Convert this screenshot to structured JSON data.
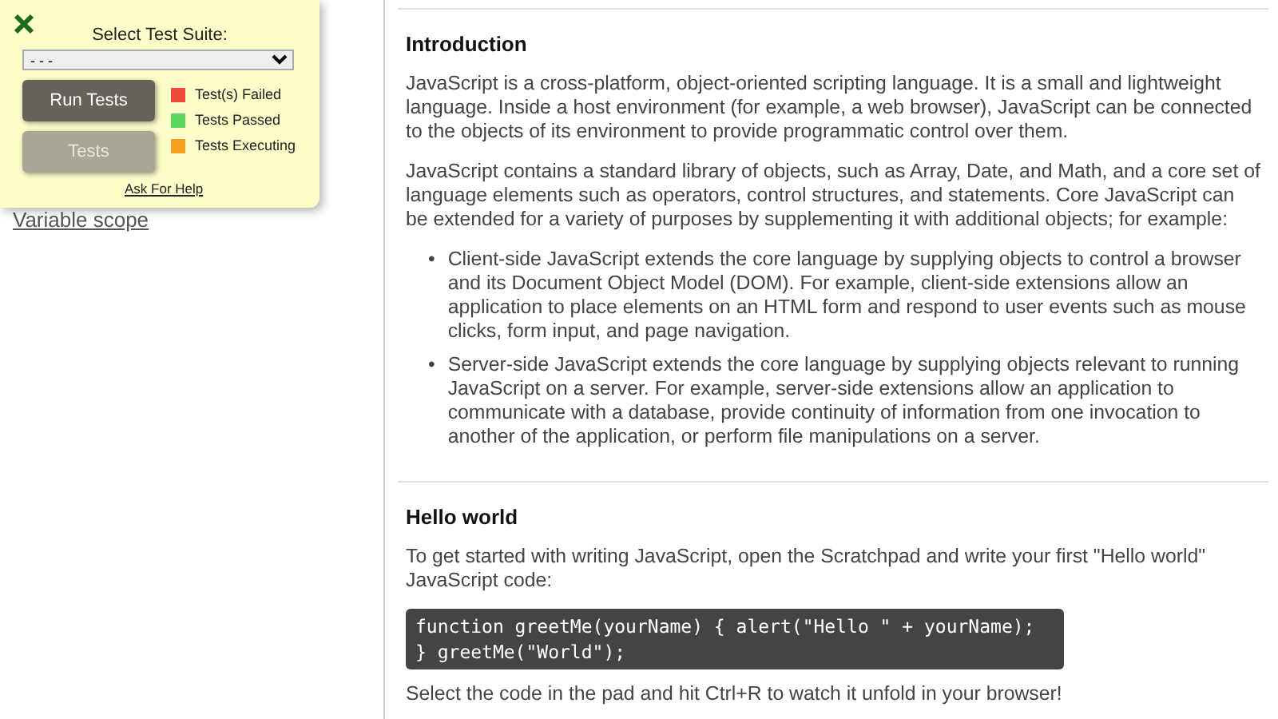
{
  "test_panel": {
    "title": "Select Test Suite:",
    "suite_select": {
      "value": "- - -"
    },
    "buttons": [
      {
        "label": "Run Tests",
        "disabled": false
      },
      {
        "label": "Tests",
        "disabled": true
      }
    ],
    "legend": [
      {
        "label": "Test(s) Failed",
        "color": "#f04a3c"
      },
      {
        "label": "Tests Passed",
        "color": "#5cd65c"
      },
      {
        "label": "Tests Executing",
        "color": "#f5a020"
      }
    ],
    "help_link": "Ask For Help"
  },
  "sidebar": {
    "links": [
      "Variable scope"
    ]
  },
  "sections": [
    {
      "heading": "Introduction",
      "blocks": [
        {
          "kind": "paragraph",
          "text": "JavaScript is a cross-platform, object-oriented scripting language. It is a small and lightweight language. Inside a host environment (for example, a web browser), JavaScript can be connected to the objects of its environment to provide programmatic control over them."
        },
        {
          "kind": "paragraph",
          "text": "JavaScript contains a standard library of objects, such as Array, Date, and Math, and a core set of language elements such as operators, control structures, and statements. Core JavaScript can be extended for a variety of purposes by supplementing it with additional objects; for example:"
        },
        {
          "kind": "list",
          "bullet": "•",
          "items": [
            "Client-side JavaScript extends the core language by supplying objects to control a browser and its Document Object Model (DOM). For example, client-side extensions allow an application to place elements on an HTML form and respond to user events such as mouse clicks, form input, and page navigation.",
            "Server-side JavaScript extends the core language by supplying objects relevant to running JavaScript on a server. For example, server-side extensions allow an application to communicate with a database, provide continuity of information from one invocation to another of the application, or perform file manipulations on a server."
          ]
        }
      ]
    },
    {
      "heading": "Hello world",
      "blocks": [
        {
          "kind": "paragraph",
          "text": "To get started with writing JavaScript, open the Scratchpad and write your first \"Hello world\" JavaScript code:"
        },
        {
          "kind": "code",
          "text": "function greetMe(yourName) { alert(\"Hello \" + yourName); } greetMe(\"World\");"
        },
        {
          "kind": "paragraph",
          "text": "Select the code in the pad and hit Ctrl+R to watch it unfold in your browser!"
        }
      ]
    }
  ]
}
